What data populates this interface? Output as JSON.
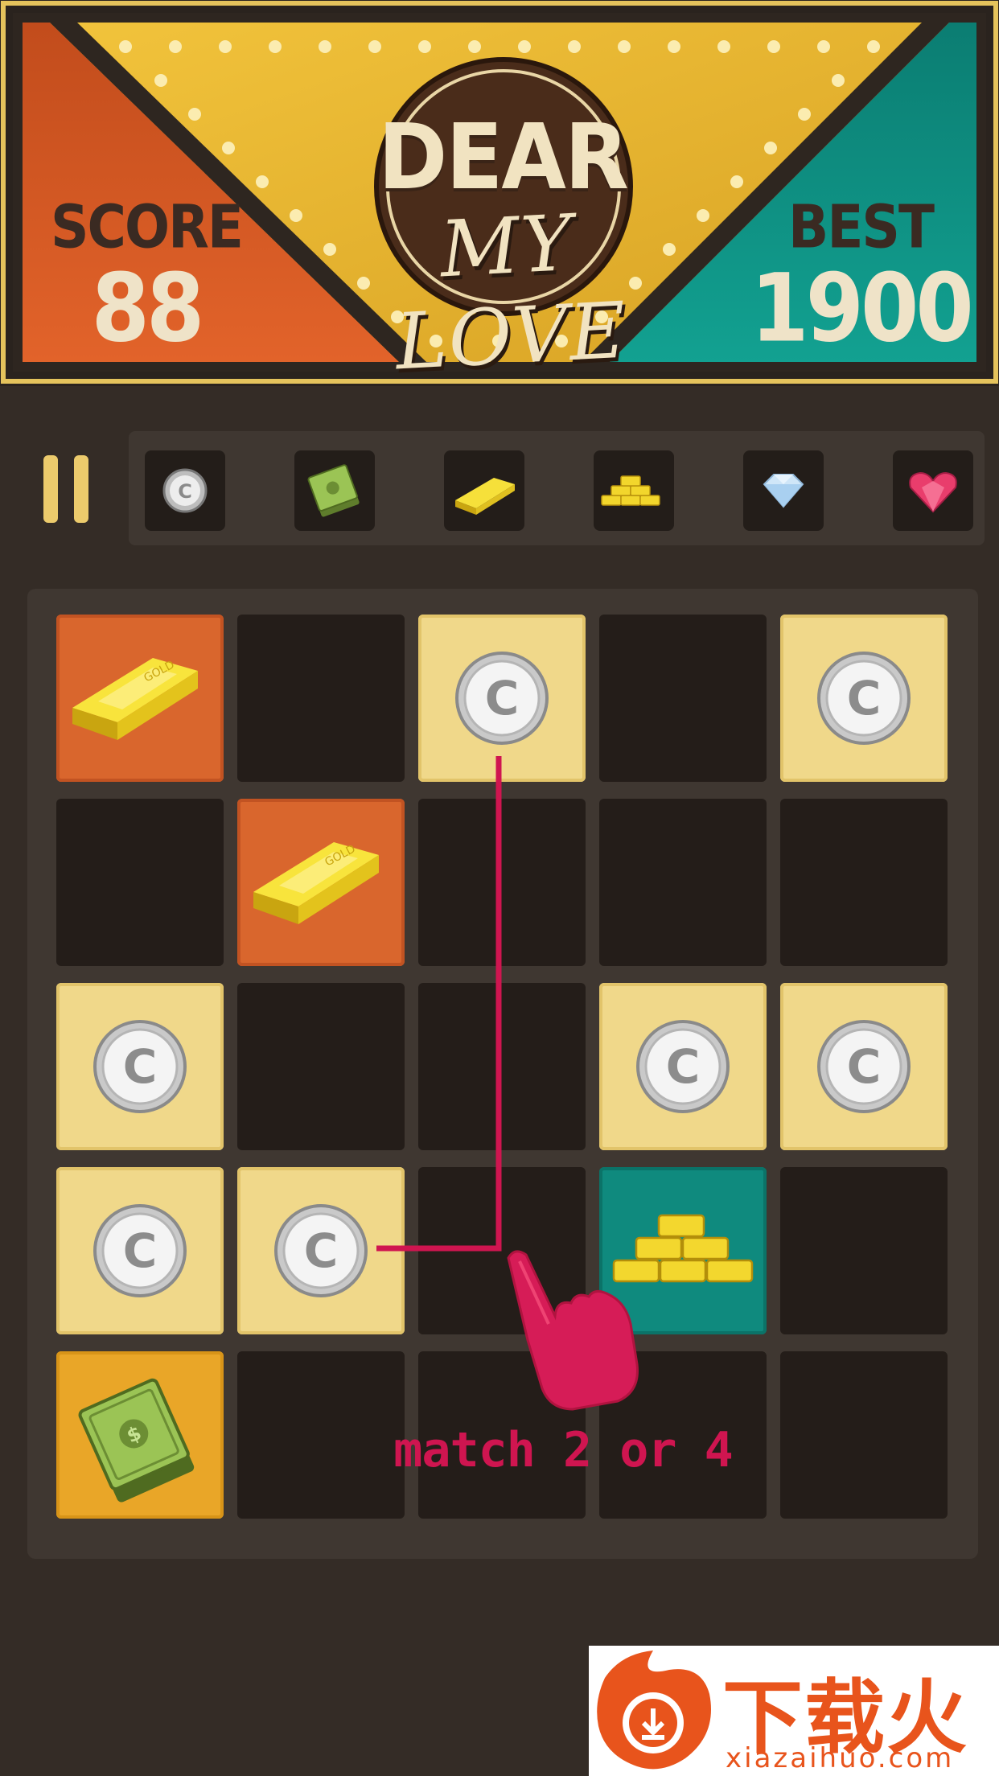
{
  "header": {
    "score_label": "SCORE",
    "score_value": "88",
    "best_label": "BEST",
    "best_value": "1900",
    "logo_line1": "DEAR",
    "logo_line2": "MY LOVE"
  },
  "colors": {
    "background": "#342c26",
    "score_panel": "#d55a22",
    "best_panel": "#10998a",
    "gold_panel": "#e8b32c",
    "coin_tile": "#f0d88a",
    "bar_tile": "#d9662d",
    "cash_tile": "#e9a628",
    "stack_tile": "#0f8a7e",
    "hint": "#cf1550"
  },
  "toolbar": {
    "pause_icon": "pause-icon",
    "sequence": [
      "coin-icon",
      "cash-icon",
      "gold-bar-icon",
      "gold-stack-icon",
      "diamond-icon",
      "heart-gem-icon"
    ]
  },
  "board": {
    "rows": [
      [
        "gold-bar",
        "empty",
        "coin",
        "empty",
        "coin"
      ],
      [
        "empty",
        "gold-bar",
        "empty",
        "empty",
        "empty"
      ],
      [
        "coin",
        "empty",
        "empty",
        "coin",
        "coin"
      ],
      [
        "coin",
        "coin",
        "empty",
        "gold-stack",
        "empty"
      ],
      [
        "cash",
        "empty",
        "empty",
        "empty",
        "empty"
      ]
    ]
  },
  "hint": {
    "text": "match 2 or 4",
    "hand_icon": "pointing-hand-icon"
  },
  "watermark": {
    "title": "下载火",
    "url": "xiazaihuo.com",
    "logo_icon": "flame-download-icon"
  }
}
